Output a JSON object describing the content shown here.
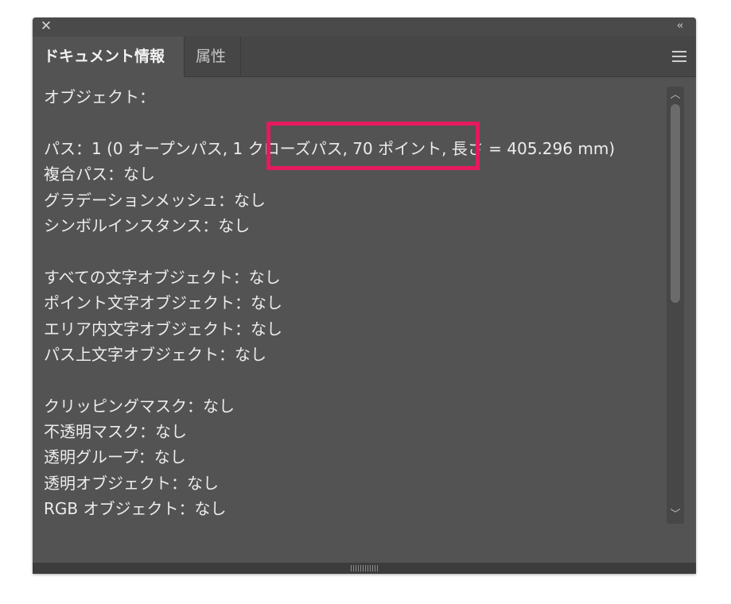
{
  "window": {
    "close_label": "✕",
    "collapse_label": "‹‹"
  },
  "tabs": [
    {
      "label": "ドキュメント情報"
    },
    {
      "label": "属性"
    }
  ],
  "content": {
    "lines": [
      "オブジェクト：",
      "",
      "パス：1 (0 オープンパス, 1 クローズパス, 70 ポイント, 長さ = 405.296 mm)",
      "複合パス：なし",
      "グラデーションメッシュ：なし",
      "シンボルインスタンス：なし",
      "",
      "すべての文字オブジェクト：なし",
      "ポイント文字オブジェクト：なし",
      "エリア内文字オブジェクト：なし",
      "パス上文字オブジェクト：なし",
      "",
      "クリッピングマスク：なし",
      "不透明マスク：なし",
      "透明グループ：なし",
      "透明オブジェクト：なし",
      "RGB オブジェクト：なし"
    ]
  },
  "scrollbar": {
    "up_label": "︿",
    "down_label": "﹀"
  },
  "colors": {
    "highlight": "#e5195f",
    "panel_bg": "#535353"
  }
}
